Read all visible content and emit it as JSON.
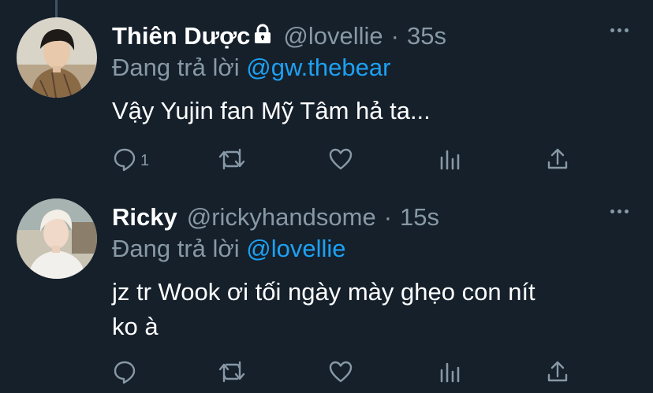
{
  "tweets": [
    {
      "name": "Thiên Dược",
      "handle": "@lovellie",
      "separator": "·",
      "time": "35s",
      "replying_prefix": "Đang trả lời",
      "replying_to": "@gw.thebear",
      "text_lines": [
        "Vậy Yujin fan Mỹ Tâm hả ta..."
      ],
      "reply_count": "1",
      "locked": true
    },
    {
      "name": "Ricky",
      "handle": "@rickyhandsome",
      "separator": "·",
      "time": "15s",
      "replying_prefix": "Đang trả lời",
      "replying_to": "@lovellie",
      "text_lines": [
        "jz tr Wook ơi tối ngày mày ghẹo con nít",
        "ko à"
      ],
      "reply_count": "",
      "locked": false
    }
  ],
  "colors": {
    "background": "#15202b",
    "secondary_text": "#8899a6",
    "link": "#1da1f2",
    "thread_line": "#3d5466"
  },
  "icons": [
    "lock-icon",
    "more-icon",
    "reply-icon",
    "retweet-icon",
    "like-icon",
    "analytics-icon",
    "share-icon"
  ]
}
